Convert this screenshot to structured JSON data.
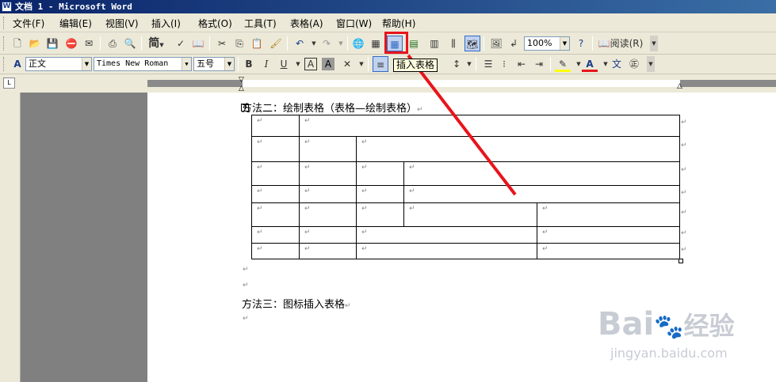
{
  "window": {
    "icon": "W",
    "title": "文档 1 - Microsoft Word"
  },
  "menu": [
    "文件(F)",
    "编辑(E)",
    "视图(V)",
    "插入(I)",
    "格式(O)",
    "工具(T)",
    "表格(A)",
    "窗口(W)",
    "帮助(H)"
  ],
  "toolbar": {
    "zoom": "100%",
    "read_label": "阅读(R)",
    "style": "正文",
    "font": "Times New Roman",
    "size": "五号",
    "simplified_label": "简"
  },
  "tooltip": "插入表格",
  "document": {
    "para1": "方法二：绘制表格（表格—绘制表格）",
    "para2": "方法三：图标插入表格",
    "para_mark": "↵"
  },
  "watermark": {
    "logo": "Bai",
    "logo2": "经验",
    "url": "jingyan.baidu.com"
  },
  "colors": {
    "highlight": "#e8141c",
    "title_bar": "#0a246a"
  }
}
